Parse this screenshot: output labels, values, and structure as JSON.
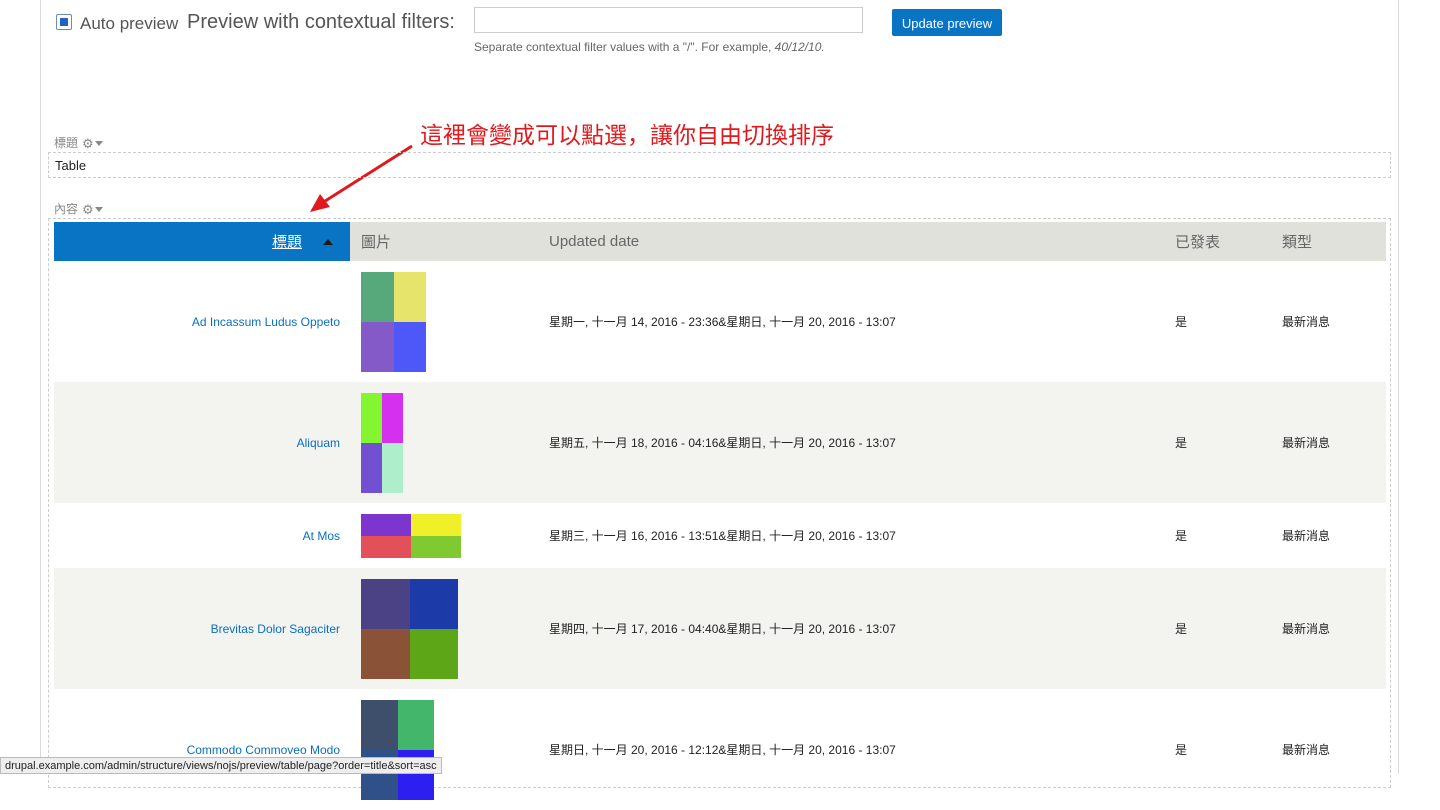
{
  "preview": {
    "auto_preview_label": "Auto preview",
    "contextual_label": "Preview with contextual filters:",
    "contextual_value": "",
    "help_text": "Separate contextual filter values with a \"/\". For example, ",
    "help_example": "40/12/10.",
    "update_button": "Update preview"
  },
  "annotation": {
    "text": "這裡會變成可以點選，讓你自由切換排序",
    "color": "#e0191d"
  },
  "header_section": {
    "label": "標題",
    "title": "Table"
  },
  "content_section": {
    "label": "內容"
  },
  "table": {
    "columns": [
      "標題",
      "圖片",
      "Updated date",
      "已發表",
      "類型"
    ],
    "rows": [
      {
        "title": "Ad Incassum Ludus Oppeto",
        "date": "星期一, 十一月 14, 2016 - 23:36&星期日, 十一月 20, 2016 - 13:07",
        "published": "是",
        "type": "最新消息",
        "colors": [
          "#57a87a",
          "#e6e46a",
          "#8459c8",
          "#4e57f8"
        ]
      },
      {
        "title": "Aliquam",
        "date": "星期五, 十一月 18, 2016 - 04:16&星期日, 十一月 20, 2016 - 13:07",
        "published": "是",
        "type": "最新消息",
        "colors": [
          "#84f531",
          "#d52ff0",
          "#7151d2",
          "#aeeecb"
        ]
      },
      {
        "title": "At Mos",
        "date": "星期三, 十一月 16, 2016 - 13:51&星期日, 十一月 20, 2016 - 13:07",
        "published": "是",
        "type": "最新消息",
        "colors": [
          "#7c36cd",
          "#efef2a",
          "#e3505a",
          "#80c930"
        ]
      },
      {
        "title": "Brevitas Dolor Sagaciter",
        "date": "星期四, 十一月 17, 2016 - 04:40&星期日, 十一月 20, 2016 - 13:07",
        "published": "是",
        "type": "最新消息",
        "colors": [
          "#4b4285",
          "#1c3aa8",
          "#8a5337",
          "#5ca618"
        ]
      },
      {
        "title": "Commodo Commoveo Modo",
        "date": "星期日, 十一月 20, 2016 - 12:12&星期日, 十一月 20, 2016 - 13:07",
        "published": "是",
        "type": "最新消息",
        "colors": [
          "#3d4f6b",
          "#43b66b",
          "#30508a",
          "#2c1ff0"
        ]
      }
    ]
  },
  "status_url": "drupal.example.com/admin/structure/views/nojs/preview/table/page?order=title&sort=asc"
}
